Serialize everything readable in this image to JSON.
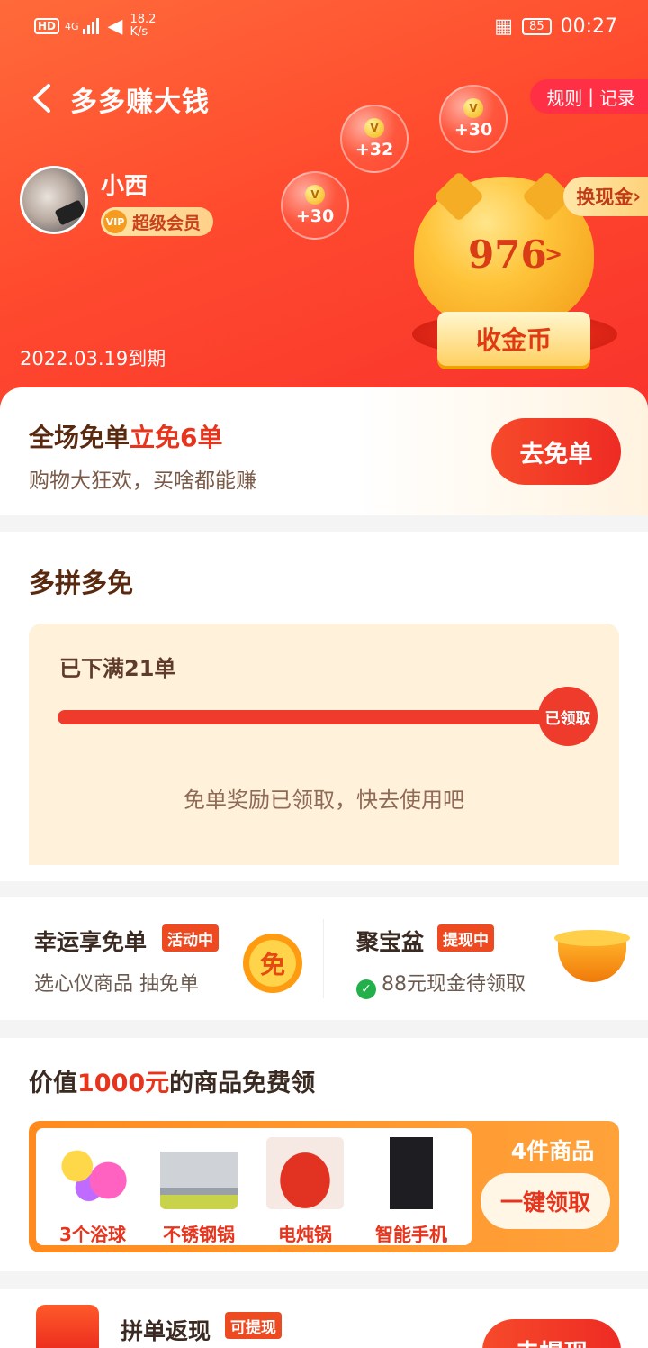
{
  "status_bar": {
    "hd": "HD",
    "network": "4G",
    "speed_value": "18.2",
    "speed_unit": "K/s",
    "battery": "85",
    "time": "00:27"
  },
  "header": {
    "title": "多多赚大钱",
    "rules": "规则",
    "records": "记录",
    "username": "小西",
    "vip_badge": "VIP",
    "vip_label": "超级会员",
    "expire": "2022.03.19到期",
    "coins": "976",
    "exchange": "换现金",
    "collect": "收金币",
    "bubbles": [
      "+32",
      "+30",
      "+30"
    ]
  },
  "free_order": {
    "title_prefix": "全场免单",
    "title_highlight": "立免6单",
    "subtitle": "购物大狂欢，买啥都能赚",
    "button": "去免单"
  },
  "multi": {
    "title": "多拼多免",
    "done": "已下满21单",
    "knob": "已领取",
    "note": "免单奖励已领取，快去使用吧",
    "progress": 1.0
  },
  "lucky": {
    "title": "幸运享免单",
    "tag": "活动中",
    "sub": "选心仪商品 抽免单",
    "coin": "免"
  },
  "treasure": {
    "title": "聚宝盆",
    "tag": "提现中",
    "sub": "88元现金待领取"
  },
  "goods": {
    "title_prefix": "价值",
    "title_highlight": "1000元",
    "title_suffix": "的商品免费领",
    "items": [
      "3个浴球",
      "不锈钢锅",
      "电炖锅",
      "智能手机"
    ],
    "count": "4件商品",
    "button": "一键领取"
  },
  "bottom": {
    "title": "拼单返现",
    "tag": "可提现",
    "button": "去提现"
  },
  "colors": {
    "primary_red": "#ef3b2b",
    "header_orange": "#ff6a3a",
    "gold": "#ffc43a"
  }
}
